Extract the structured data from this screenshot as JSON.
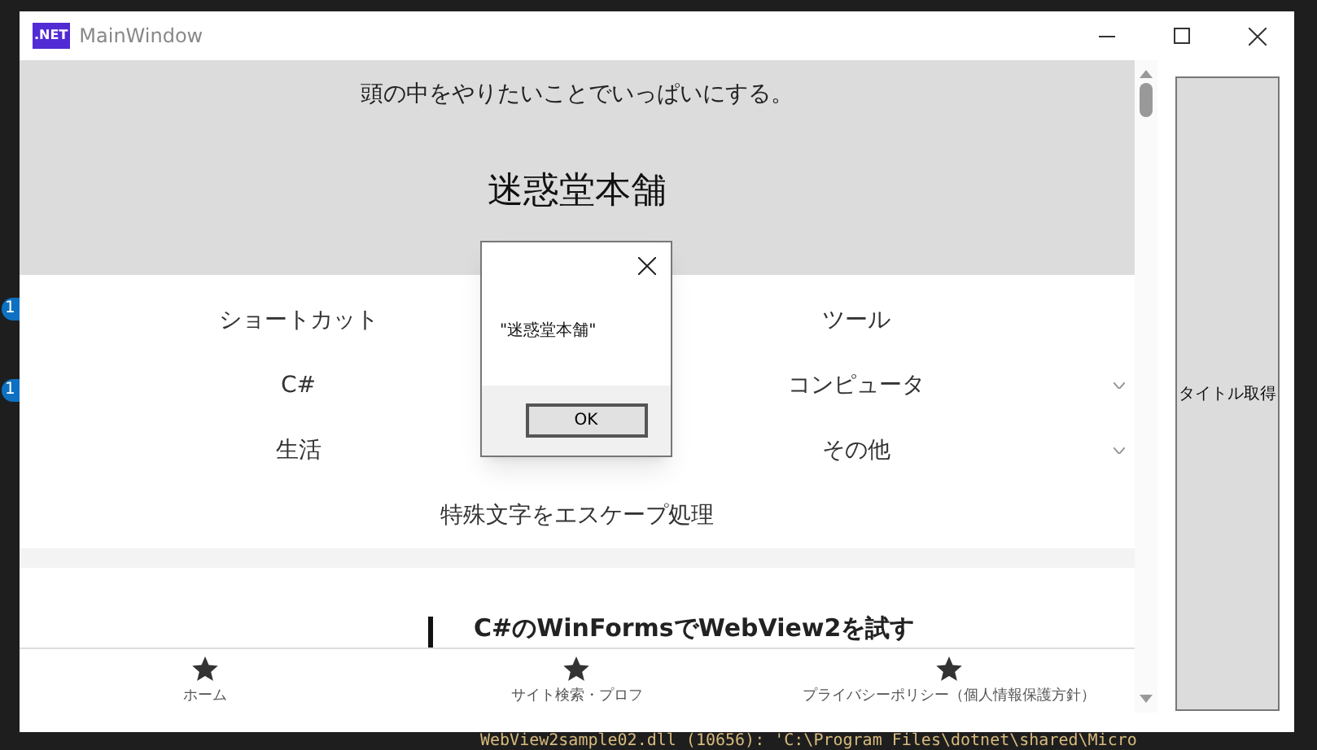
{
  "window": {
    "title": "MainWindow",
    "app_badge": ".NET"
  },
  "page": {
    "tagline": "頭の中をやりたいことでいっぱいにする。",
    "site_title": "迷惑堂本舗",
    "nav": [
      {
        "label": "ショートカット"
      },
      {
        "label": "ツール",
        "dropdown": false
      },
      {
        "label": "C#"
      },
      {
        "label": "コンピュータ",
        "dropdown": true
      },
      {
        "label": "生活"
      },
      {
        "label": "その他",
        "dropdown": true
      }
    ],
    "escape_link": "特殊文字をエスケープ処理",
    "article": {
      "heading": "C#のWinFormsでWebView2を試す"
    },
    "bottom_nav": [
      {
        "label": "ホーム"
      },
      {
        "label": "サイト検索・プロフ"
      },
      {
        "label": "プライバシーポリシー（個人情報保護方針）"
      }
    ]
  },
  "side_button": "タイトル取得",
  "dialog": {
    "message": "\"迷惑堂本舗\"",
    "button": "OK"
  },
  "background": {
    "badges": [
      "1",
      "1"
    ],
    "output_line": "WebView2sample02.dll (10656): 'C:\\Program Files\\dotnet\\shared\\Micro"
  }
}
